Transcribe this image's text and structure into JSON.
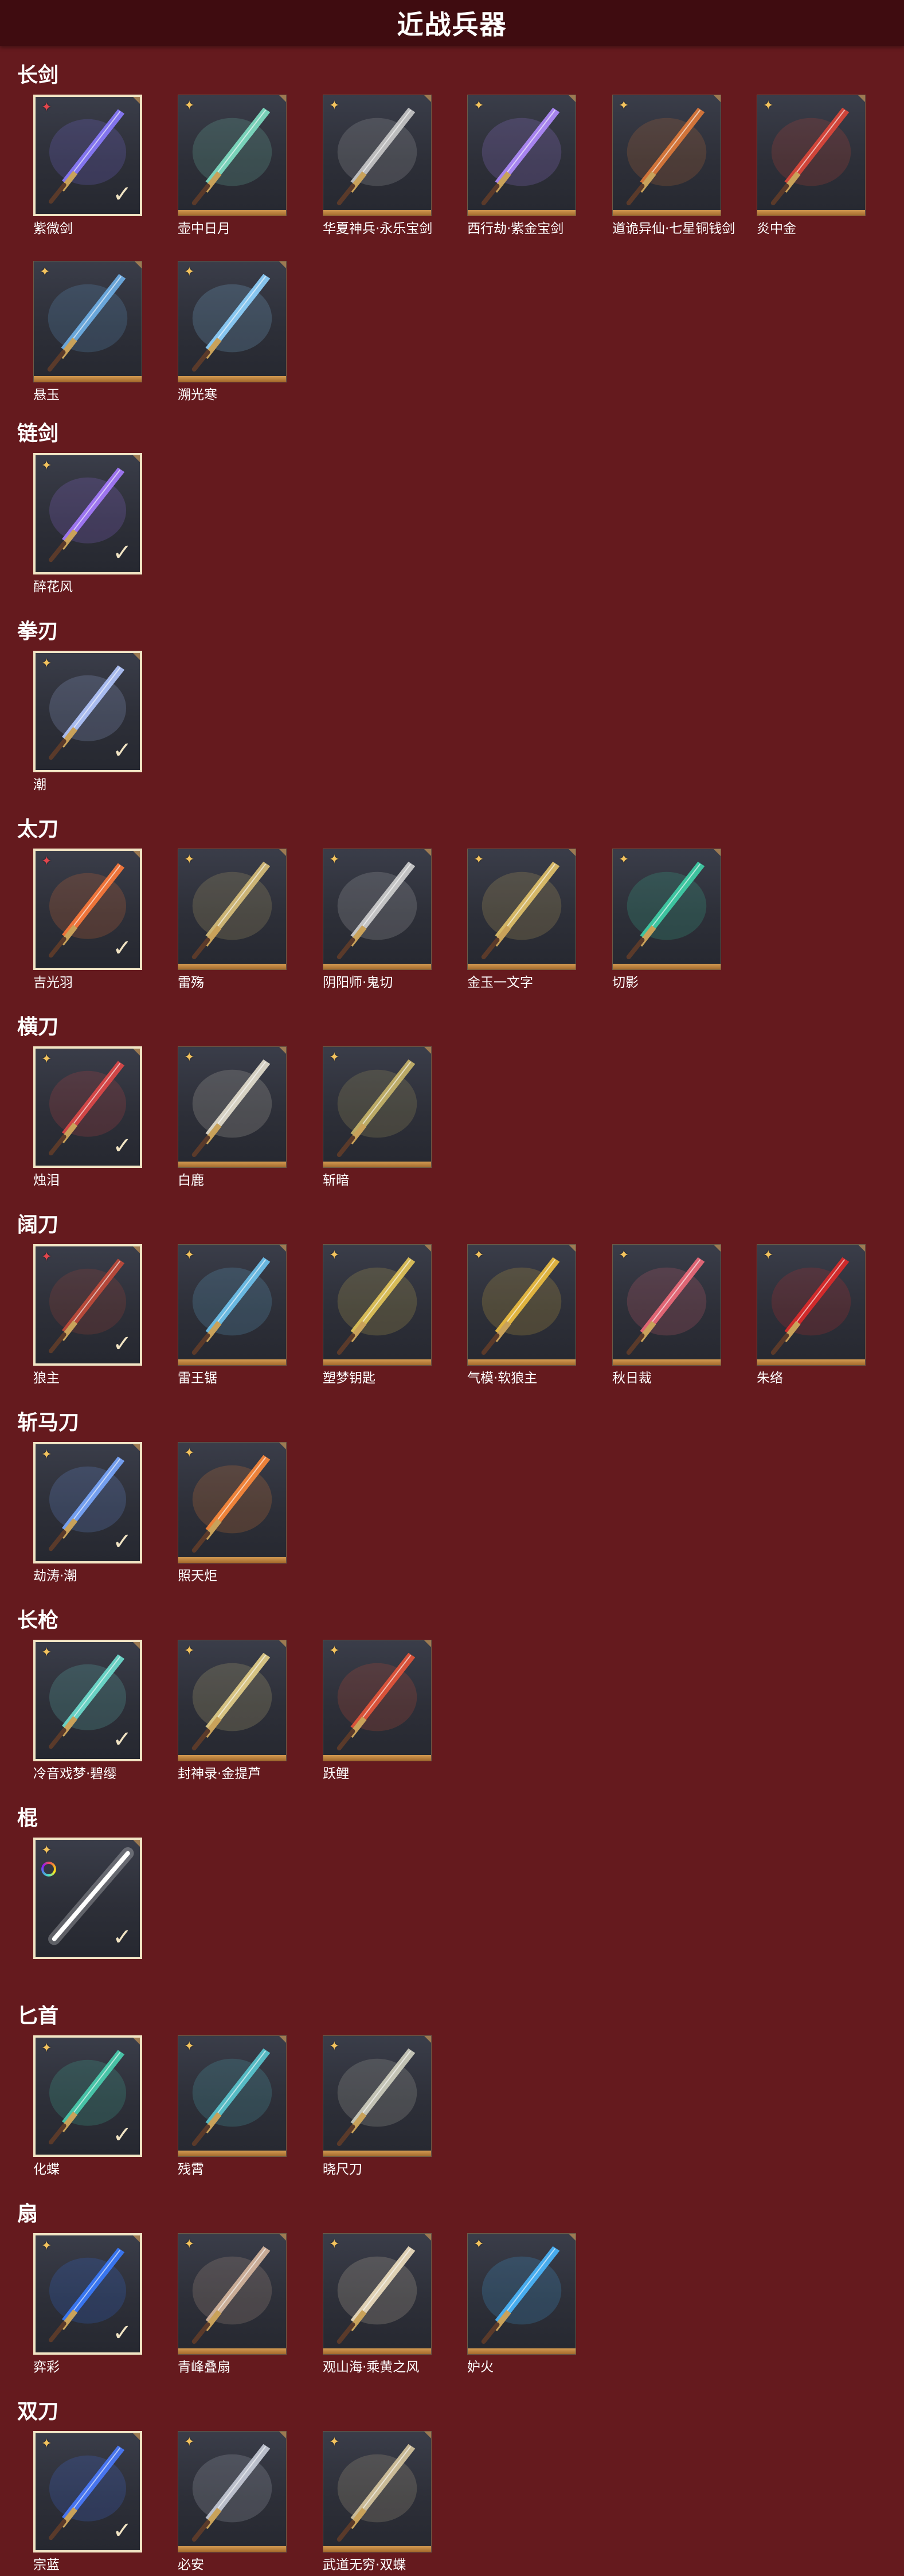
{
  "page": {
    "title": "近战兵器"
  },
  "colors": {
    "background": "#651a1e",
    "header": "#3f0c10",
    "gold": "#f3c35e",
    "red_rank": "#e2464d",
    "selected_border": "#f1e4c4"
  },
  "sections": [
    {
      "title": "长剑",
      "items": [
        {
          "name": "紫微剑",
          "rank": "red",
          "selected": true,
          "accent": "#8b7bff"
        },
        {
          "name": "壶中日月",
          "rank": "gold",
          "selected": false,
          "accent": "#7fe0c4"
        },
        {
          "name": "华夏神兵·永乐宝剑",
          "rank": "gold",
          "selected": false,
          "accent": "#c9c9c9"
        },
        {
          "name": "西行劫·紫金宝剑",
          "rank": "gold",
          "selected": false,
          "accent": "#b18cff"
        },
        {
          "name": "道诡异仙·七星铜钱剑",
          "rank": "gold",
          "selected": false,
          "accent": "#e07a3a"
        },
        {
          "name": "炎中金",
          "rank": "gold",
          "selected": false,
          "accent": "#e0473a"
        },
        {
          "name": "悬玉",
          "rank": "gold",
          "selected": false,
          "accent": "#6fb0e8"
        },
        {
          "name": "溯光寒",
          "rank": "gold",
          "selected": false,
          "accent": "#8fd3ff"
        }
      ]
    },
    {
      "title": "链剑",
      "items": [
        {
          "name": "醉花风",
          "rank": "gold",
          "selected": true,
          "accent": "#a67bff"
        }
      ]
    },
    {
      "title": "拳刃",
      "items": [
        {
          "name": "潮",
          "rank": "gold",
          "selected": true,
          "accent": "#b4c8ff"
        }
      ]
    },
    {
      "title": "太刀",
      "items": [
        {
          "name": "吉光羽",
          "rank": "red",
          "selected": true,
          "accent": "#ff7a3a"
        },
        {
          "name": "雷殇",
          "rank": "gold",
          "selected": false,
          "accent": "#d9c07a"
        },
        {
          "name": "阴阳师·鬼切",
          "rank": "gold",
          "selected": false,
          "accent": "#d0d0d0"
        },
        {
          "name": "金玉一文字",
          "rank": "gold",
          "selected": false,
          "accent": "#e3c36a"
        },
        {
          "name": "切影",
          "rank": "gold",
          "selected": false,
          "accent": "#3fd1a8"
        }
      ]
    },
    {
      "title": "横刀",
      "items": [
        {
          "name": "烛泪",
          "rank": "gold",
          "selected": true,
          "accent": "#e04848"
        },
        {
          "name": "白鹿",
          "rank": "gold",
          "selected": false,
          "accent": "#e6e0cf"
        },
        {
          "name": "斩暗",
          "rank": "gold",
          "selected": false,
          "accent": "#c9b66a"
        }
      ]
    },
    {
      "title": "阔刀",
      "items": [
        {
          "name": "狼主",
          "rank": "red",
          "selected": true,
          "accent": "#c24a3a"
        },
        {
          "name": "雷王锯",
          "rank": "gold",
          "selected": false,
          "accent": "#6fc4ef"
        },
        {
          "name": "塑梦钥匙",
          "rank": "gold",
          "selected": false,
          "accent": "#e6c85a"
        },
        {
          "name": "气模·软狼主",
          "rank": "gold",
          "selected": false,
          "accent": "#f0c040"
        },
        {
          "name": "秋日裁",
          "rank": "gold",
          "selected": false,
          "accent": "#f06a7a"
        },
        {
          "name": "朱络",
          "rank": "gold",
          "selected": false,
          "accent": "#e02a2a"
        }
      ]
    },
    {
      "title": "斩马刀",
      "items": [
        {
          "name": "劫涛·潮",
          "rank": "gold",
          "selected": true,
          "accent": "#7aa8ff"
        },
        {
          "name": "照天炬",
          "rank": "gold",
          "selected": false,
          "accent": "#ff8a3a"
        }
      ]
    },
    {
      "title": "长枪",
      "items": [
        {
          "name": "冷音戏梦·碧缨",
          "rank": "gold",
          "selected": true,
          "accent": "#6fe0d0"
        },
        {
          "name": "封神录·金提芦",
          "rank": "gold",
          "selected": false,
          "accent": "#e6d08a"
        },
        {
          "name": "跃鲤",
          "rank": "gold",
          "selected": false,
          "accent": "#e8553a"
        }
      ]
    },
    {
      "title": "棍",
      "items": [
        {
          "name": "",
          "rank": "gold",
          "selected": true,
          "ring": true,
          "accent": "#ffffff"
        }
      ]
    },
    {
      "title": "匕首",
      "items": [
        {
          "name": "化蝶",
          "rank": "gold",
          "selected": true,
          "accent": "#4ad0b0"
        },
        {
          "name": "残霄",
          "rank": "gold",
          "selected": false,
          "accent": "#5ac8d0"
        },
        {
          "name": "晓尺刀",
          "rank": "gold",
          "selected": false,
          "accent": "#d0d0c0"
        }
      ]
    },
    {
      "title": "扇",
      "items": [
        {
          "name": "弈彩",
          "rank": "gold",
          "selected": true,
          "accent": "#3a7bff"
        },
        {
          "name": "青峰叠扇",
          "rank": "gold",
          "selected": false,
          "accent": "#d8b8a0"
        },
        {
          "name": "观山海·乘黄之风",
          "rank": "gold",
          "selected": false,
          "accent": "#f0e0c0"
        },
        {
          "name": "妒火",
          "rank": "gold",
          "selected": false,
          "accent": "#4ab8ff"
        }
      ]
    },
    {
      "title": "双刀",
      "items": [
        {
          "name": "宗蓝",
          "rank": "gold",
          "selected": true,
          "accent": "#4a7bff"
        },
        {
          "name": "必安",
          "rank": "gold",
          "selected": false,
          "accent": "#c8ccd8"
        },
        {
          "name": "武道无穷·双蝶",
          "rank": "gold",
          "selected": false,
          "accent": "#d8c8a0"
        }
      ]
    }
  ]
}
